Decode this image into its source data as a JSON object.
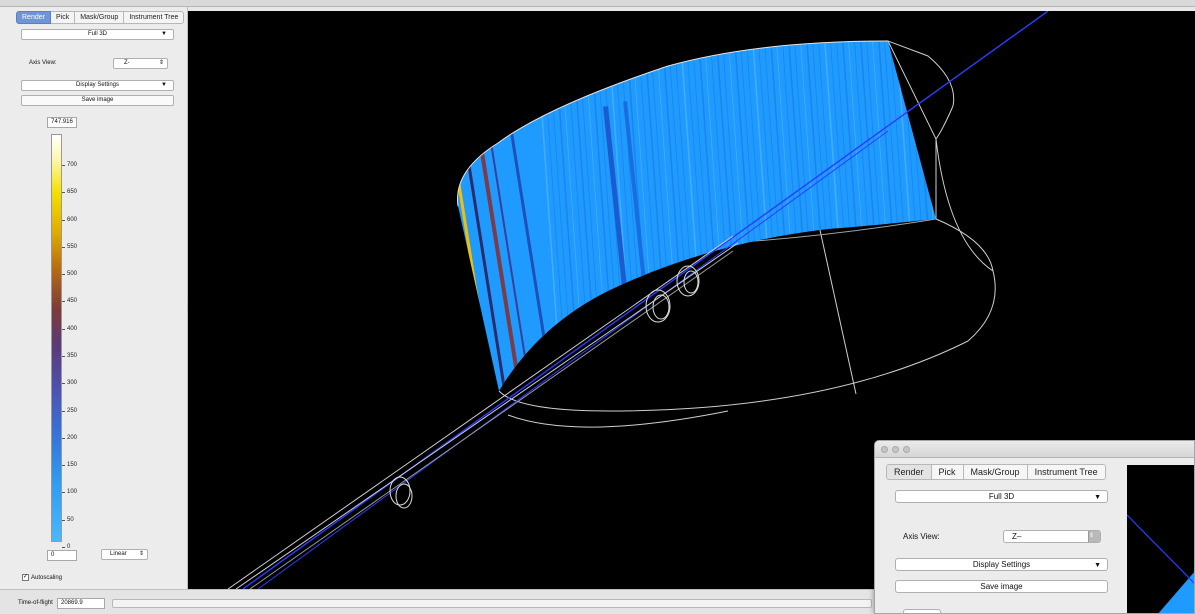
{
  "tabs": [
    "Render",
    "Pick",
    "Mask/Group",
    "Instrument Tree"
  ],
  "render_mode": "Full 3D",
  "axis_view": {
    "label": "Axis View:",
    "value": "Z-"
  },
  "display_settings": "Display Settings",
  "save_image": "Save image",
  "colorbar": {
    "max": "747.916",
    "min": "0",
    "scale": "Linear",
    "ticks": [
      "700",
      "650",
      "600",
      "550",
      "500",
      "450",
      "400",
      "350",
      "300",
      "250",
      "200",
      "150",
      "100",
      "50",
      "0"
    ],
    "autoscaling": "Autoscaling"
  },
  "time_of_flight": {
    "label": "Time-of-flight",
    "value": "20869.9"
  },
  "float_window": {
    "tabs": [
      "Render",
      "Pick",
      "Mask/Group",
      "Instrument Tree"
    ],
    "render_mode": "Full 3D",
    "axis_label": "Axis View:",
    "axis_value": "Z–",
    "display_settings": "Display Settings",
    "save_image": "Save image"
  },
  "colors": {
    "detector_blue": "#1f9bff",
    "beam_line": "#2a3cff",
    "wireframe": "#cfcfcf"
  }
}
